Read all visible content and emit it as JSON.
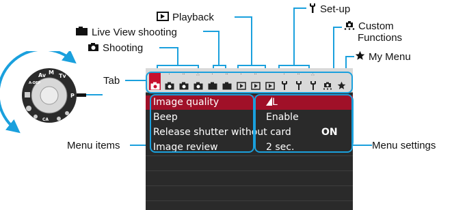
{
  "callouts": {
    "playback": "Playback",
    "setup": "Set-up",
    "live_view": "Live View shooting",
    "custom_line1": "Custom",
    "custom_line2": "Functions",
    "shooting": "Shooting",
    "my_menu": "My Menu",
    "tab": "Tab",
    "menu_items": "Menu items",
    "menu_settings": "Menu settings"
  },
  "dial": {
    "labels": [
      "Av",
      "M",
      "Tv",
      "P",
      "A-DEP",
      "CA"
    ],
    "accent": "#1aa0dd"
  },
  "screen": {
    "tabs": [
      {
        "icon": "camera-icon",
        "dots": "",
        "active": true
      },
      {
        "icon": "camera-icon",
        "dots": "·"
      },
      {
        "icon": "camera-icon",
        "dots": "··"
      },
      {
        "icon": "camera-icon",
        "dots": "∴"
      },
      {
        "icon": "live-view-camera-icon",
        "dots": "·"
      },
      {
        "icon": "live-view-camera-icon",
        "dots": "··"
      },
      {
        "icon": "play-icon",
        "dots": "·"
      },
      {
        "icon": "play-icon",
        "dots": "··"
      },
      {
        "icon": "play-icon",
        "dots": ""
      },
      {
        "icon": "wrench-icon",
        "dots": "·"
      },
      {
        "icon": "wrench-icon",
        "dots": "··"
      },
      {
        "icon": "wrench-icon",
        "dots": "∴"
      },
      {
        "icon": "custom-functions-icon",
        "dots": ""
      },
      {
        "icon": "star-icon",
        "dots": ""
      }
    ],
    "items": [
      {
        "name": "Image quality",
        "value": "L",
        "value_icon": "large-quality-icon",
        "selected": true
      },
      {
        "name": "Beep",
        "value": "Enable"
      },
      {
        "name": "Release shutter without card",
        "value": "ON"
      },
      {
        "name": "Image review",
        "value": "2 sec."
      }
    ],
    "colors": {
      "selected_row": "#a01028",
      "active_tab": "#c8102e",
      "highlight": "#1aa0dd"
    }
  }
}
